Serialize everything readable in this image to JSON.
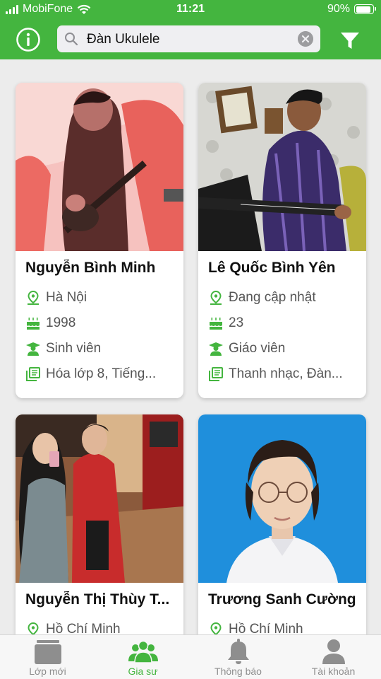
{
  "status_bar": {
    "carrier": "MobiFone",
    "time": "11:21",
    "battery": "90%",
    "battery_level": 0.9
  },
  "header": {
    "info_icon": "info-icon",
    "search": {
      "value": "Đàn Ukulele",
      "icon": "search-icon",
      "clear_icon": "clear-icon"
    },
    "filter_icon": "filter-icon"
  },
  "colors": {
    "brand_green": "#44b53f",
    "icon_green": "#44b53f",
    "inactive_grey": "#8e8e8e"
  },
  "tutors": [
    {
      "name": "Nguyễn Bình Minh",
      "location": "Hà Nội",
      "birth_year": "1998",
      "occupation": "Sinh viên",
      "subjects": "Hóa lớp 8, Tiếng..."
    },
    {
      "name": "Lê Quốc Bình Yên",
      "location": "Đang cập nhật",
      "birth_year": "23",
      "occupation": "Giáo viên",
      "subjects": "Thanh nhạc, Đàn..."
    },
    {
      "name": "Nguyễn Thị Thùy T...",
      "location": "Hồ Chí Minh"
    },
    {
      "name": "Trương Sanh Cường",
      "location": "Hồ Chí Minh"
    }
  ],
  "tabs": [
    {
      "label": "Lớp mới",
      "icon": "classes-icon",
      "active": false
    },
    {
      "label": "Gia sư",
      "icon": "tutors-icon",
      "active": true
    },
    {
      "label": "Thông báo",
      "icon": "bell-icon",
      "active": false
    },
    {
      "label": "Tài khoản",
      "icon": "account-icon",
      "active": false
    }
  ]
}
